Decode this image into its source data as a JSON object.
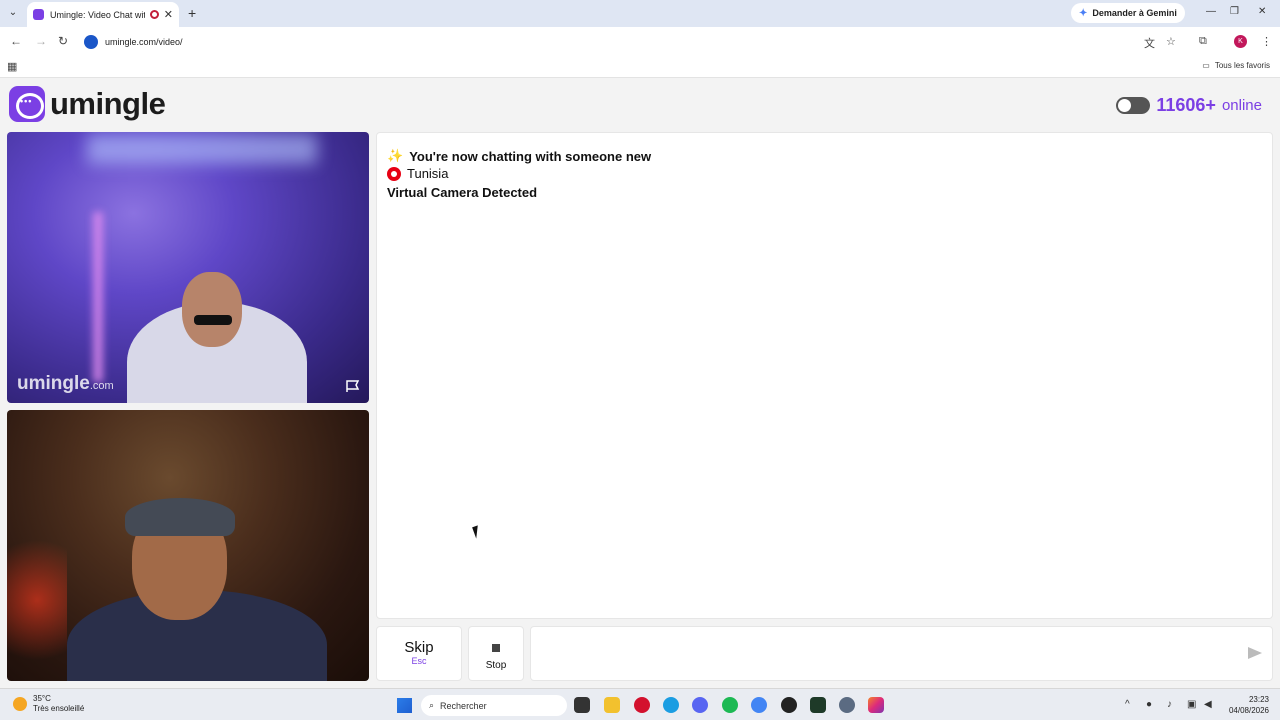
{
  "browser": {
    "tab_title": "Umingle: Video Chat with S",
    "url": "umingle.com/video/",
    "gemini_label": "Demander à Gemini",
    "profile_initial": "K",
    "bookmarks_all": "Tous les favoris"
  },
  "header": {
    "logo_text": "umingle",
    "online_count": "11606+",
    "online_label": "online"
  },
  "videos": {
    "watermark_main": "umingle",
    "watermark_suffix": ".com"
  },
  "chat": {
    "messages": [
      {
        "text": "You're now chatting with someone new",
        "icon": "sparkle-icon"
      },
      {
        "text": "Tunisia",
        "icon": "tunisia-flag-icon"
      },
      {
        "text": "Virtual Camera Detected"
      }
    ]
  },
  "controls": {
    "skip_label": "Skip",
    "skip_hint": "Esc",
    "stop_label": "Stop"
  },
  "taskbar": {
    "temperature": "35°C",
    "weather": "Très ensoleillé",
    "search_placeholder": "Rechercher",
    "time": "23:23",
    "date": "04/08/2026"
  },
  "colors": {
    "brand": "#7b3fe4",
    "tab_bar": "#dfe6f3"
  }
}
